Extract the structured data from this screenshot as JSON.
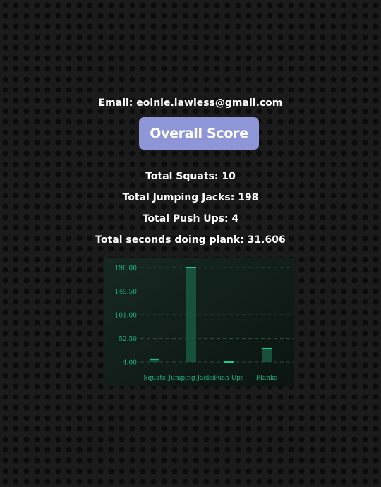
{
  "profile": {
    "email": "Email: eoinie.lawless@gmail.com"
  },
  "overall_score_button": "Overall Score",
  "stats": [
    "Total Squats: 10",
    "Total Jumping Jacks: 198",
    "Total Push Ups: 4",
    "Total seconds doing plank: 31.606"
  ],
  "colors": {
    "button": "#8e96d8",
    "chart_text": "#1fb57b",
    "bar_fill": "#1a5a40",
    "bar_top": "#1fc98a"
  },
  "chart_data": {
    "type": "bar",
    "categories": [
      "Squats",
      "Jumping Jacks",
      "Push Ups",
      "Planks"
    ],
    "values": [
      10,
      198,
      4,
      31.606
    ],
    "yticks": [
      "198.00",
      "149.50",
      "101.00",
      "52.50",
      "4.00"
    ],
    "ylim": [
      4,
      198
    ],
    "grid": true,
    "title": "",
    "xlabel": "",
    "ylabel": ""
  }
}
